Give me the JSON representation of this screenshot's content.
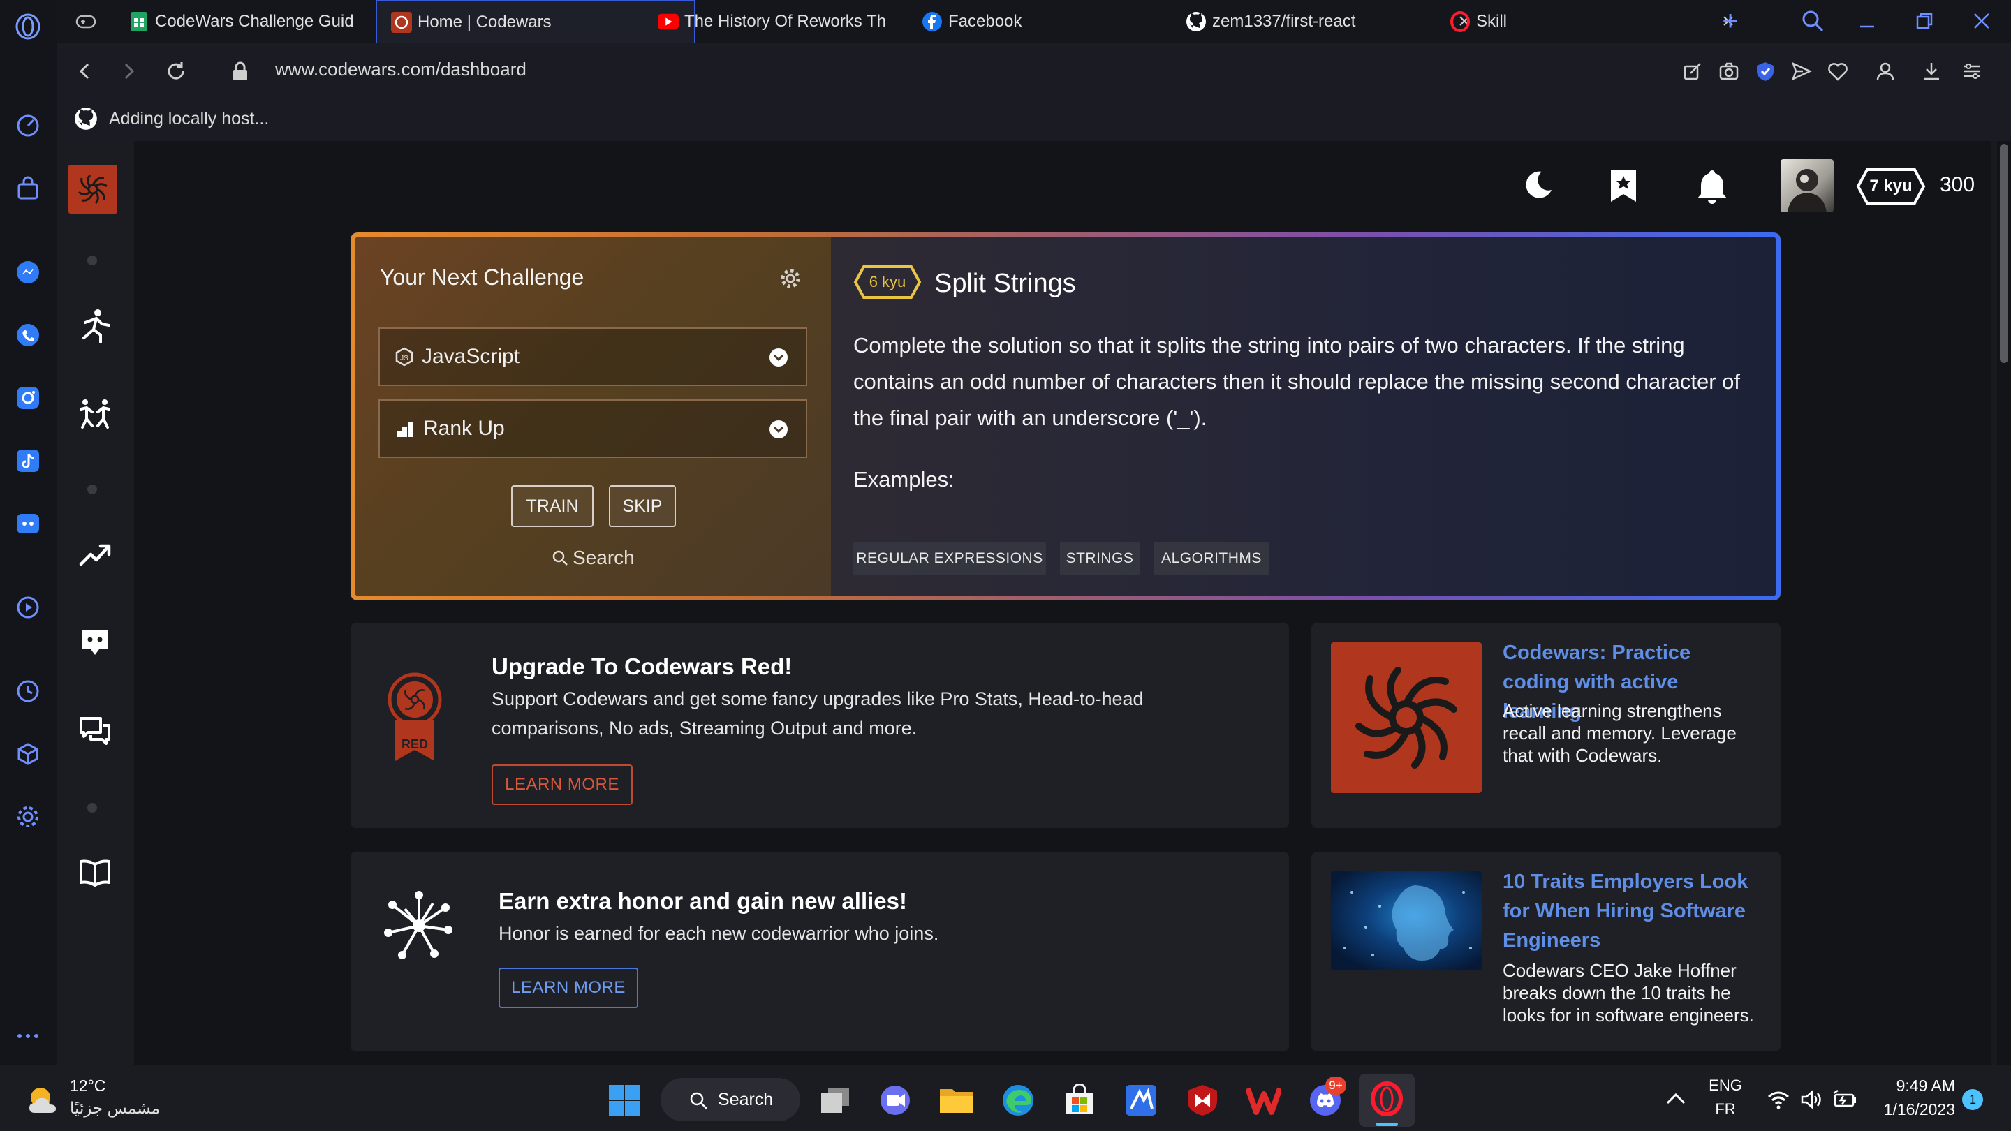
{
  "browser": {
    "tabs": [
      {
        "title": "CodeWars Challenge Guid",
        "icon": "sheets-icon"
      },
      {
        "title": "Home | Codewars",
        "icon": "codewars-icon",
        "active": true
      },
      {
        "title": "The History Of Reworks Th",
        "icon": "youtube-icon"
      },
      {
        "title": "Facebook",
        "icon": "facebook-icon"
      },
      {
        "title": "zem1337/first-react",
        "icon": "github-icon"
      },
      {
        "title": "Skill",
        "icon": "opera-icon"
      }
    ],
    "url": "www.codewars.com/dashboard",
    "bookmark": "Adding locally host..."
  },
  "header": {
    "rank_badge": "7 kyu",
    "honor": "300"
  },
  "challenge": {
    "heading": "Your Next Challenge",
    "language": "JavaScript",
    "strategy": "Rank Up",
    "train_label": "TRAIN",
    "skip_label": "SKIP",
    "search_label": "Search",
    "kyu": "6 kyu",
    "title": "Split Strings",
    "description": "Complete the solution so that it splits the string into pairs of two characters. If the string contains an odd number of characters then it should replace the missing second character of the final pair with an underscore ('_').",
    "examples_label": "Examples:",
    "tags": [
      "REGULAR EXPRESSIONS",
      "STRINGS",
      "ALGORITHMS"
    ]
  },
  "promo_red": {
    "badge_text": "RED",
    "title": "Upgrade To Codewars Red!",
    "text": "Support Codewars and get some fancy upgrades like Pro Stats, Head-to-head comparisons, No ads, Streaming Output and more.",
    "button": "LEARN MORE"
  },
  "promo_honor": {
    "title": "Earn extra honor and gain new allies!",
    "text": "Honor is earned for each new codewarrior who joins.",
    "button": "LEARN MORE"
  },
  "blog": [
    {
      "title": "Codewars: Practice coding with active learning",
      "text": "Active learning strengthens recall and memory. Leverage that with Codewars."
    },
    {
      "title": "10 Traits Employers Look for When Hiring Software Engineers",
      "text": "Codewars CEO Jake Hoffner breaks down the 10 traits he looks for in software engineers."
    }
  ],
  "taskbar": {
    "weather_temp": "12°C",
    "weather_desc": "مشمس جزئيًا",
    "search_label": "Search",
    "discord_badge": "9+",
    "lang_1": "ENG",
    "lang_2": "FR",
    "time": "9:49 AM",
    "date": "1/16/2023",
    "notif_count": "1"
  },
  "colors": {
    "codewars_red": "#b1361e",
    "accent_blue": "#3b6bf0",
    "accent_orange": "#e68a2e",
    "link_blue": "#5f8ee6",
    "kyu_yellow": "#e9c542"
  }
}
